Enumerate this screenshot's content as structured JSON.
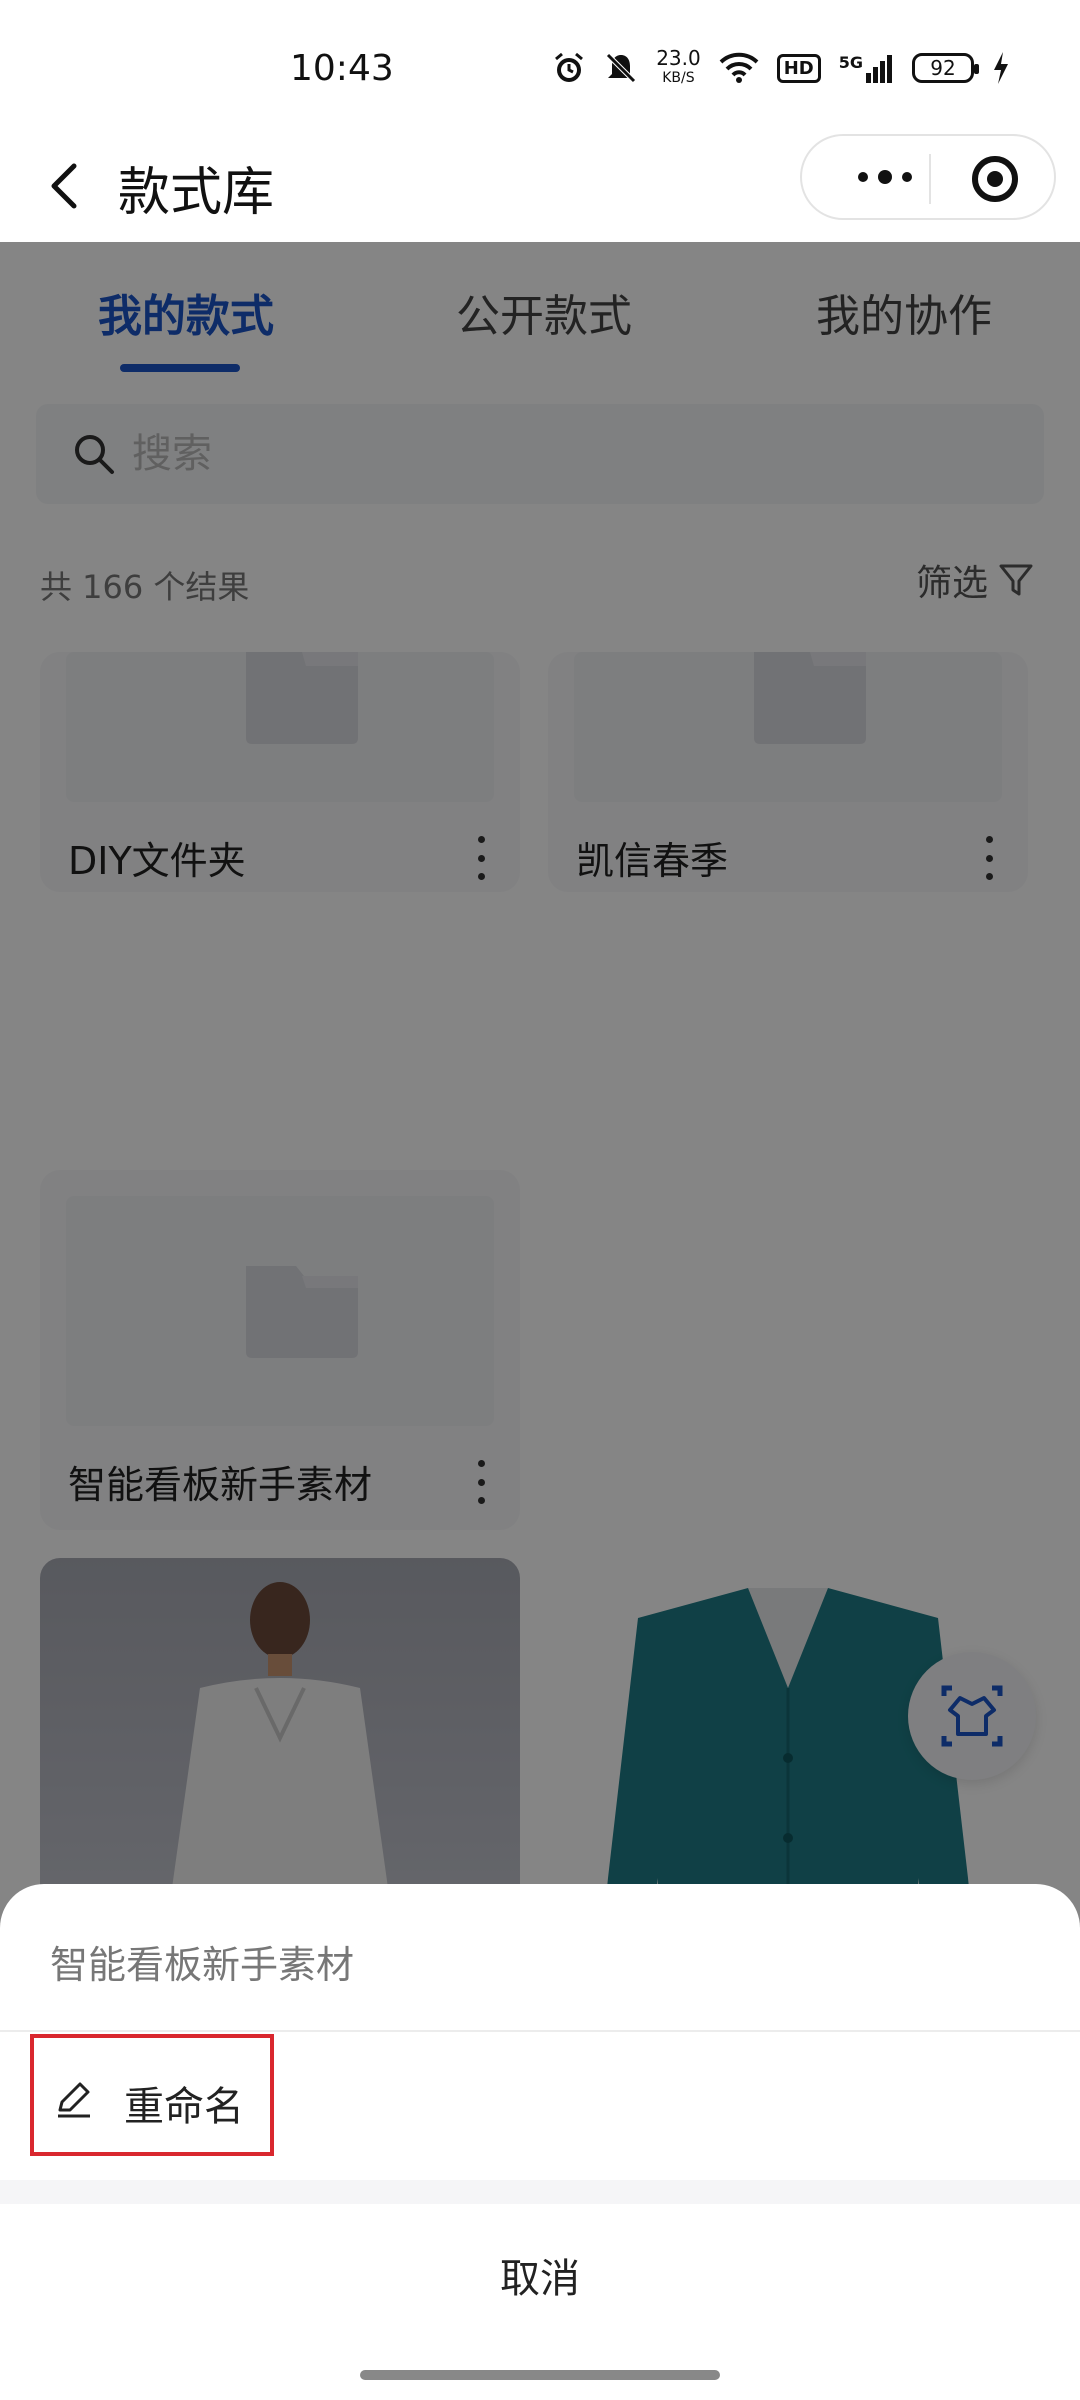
{
  "status_bar": {
    "time": "10:43",
    "net_speed_value": "23.0",
    "net_speed_unit": "KB/S",
    "hd_label": "HD",
    "network": "5G",
    "battery": "92",
    "icons": [
      "alarm-icon",
      "mute-icon",
      "wifi-icon",
      "signal-icon",
      "charging-icon"
    ]
  },
  "nav": {
    "title": "款式库",
    "back_icon": "chevron-left-icon",
    "more_icon": "more-dots-icon",
    "close_icon": "target-icon"
  },
  "tabs": [
    {
      "label": "我的款式",
      "active": true
    },
    {
      "label": "公开款式",
      "active": false
    },
    {
      "label": "我的协作",
      "active": false
    }
  ],
  "search": {
    "placeholder": "搜索"
  },
  "results": {
    "count_text": "共 166 个结果",
    "filter_label": "筛选"
  },
  "folders": [
    {
      "name": "DIY文件夹"
    },
    {
      "name": "凯信春季"
    },
    {
      "name": "智能看板新手素材"
    }
  ],
  "style_items": [
    {
      "name": "white-cardigan-model"
    },
    {
      "name": "teal-cardigan"
    }
  ],
  "sheet": {
    "title": "智能看板新手素材",
    "rename_label": "重命名",
    "cancel_label": "取消"
  },
  "colors": {
    "accent": "#1b55c8",
    "highlight_border": "#d9272e",
    "overlay": "rgba(0,0,0,0.48)"
  }
}
